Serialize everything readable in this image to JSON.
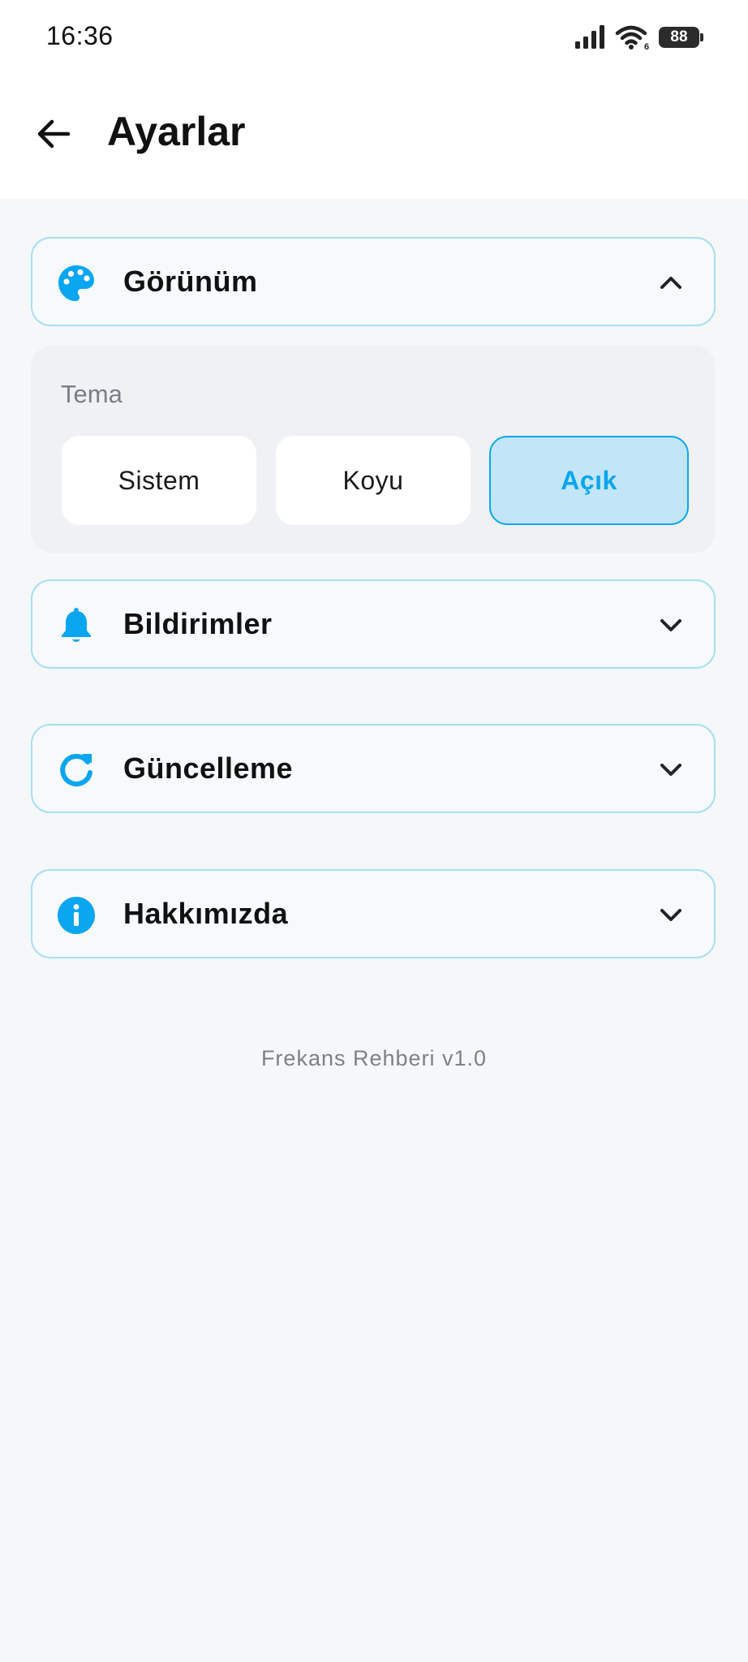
{
  "status_bar": {
    "time": "16:36",
    "battery": "88",
    "icons": [
      "signal-icon",
      "wifi-icon",
      "battery-icon"
    ]
  },
  "app_bar": {
    "back_icon": "arrow-left-icon",
    "title": "Ayarlar"
  },
  "sections": [
    {
      "key": "appearance",
      "label": "Görünüm",
      "icon": "palette-icon",
      "expanded": true,
      "panel": {
        "label": "Tema",
        "options": [
          "Sistem",
          "Koyu",
          "Açık"
        ],
        "selected": "Açık"
      }
    },
    {
      "key": "notifications",
      "label": "Bildirimler",
      "icon": "bell-icon",
      "expanded": false
    },
    {
      "key": "update",
      "label": "Güncelleme",
      "icon": "refresh-icon",
      "expanded": false
    },
    {
      "key": "about",
      "label": "Hakkımızda",
      "icon": "info-icon",
      "expanded": false
    }
  ],
  "footer": {
    "version": "Frekans Rehberi v1.0"
  },
  "colors": {
    "accent": "#0aa6ef",
    "border": "#a9def3",
    "selected_bg": "#c2e6f8",
    "background": "#f5f7f9",
    "panel_bg": "#eff1f4"
  }
}
